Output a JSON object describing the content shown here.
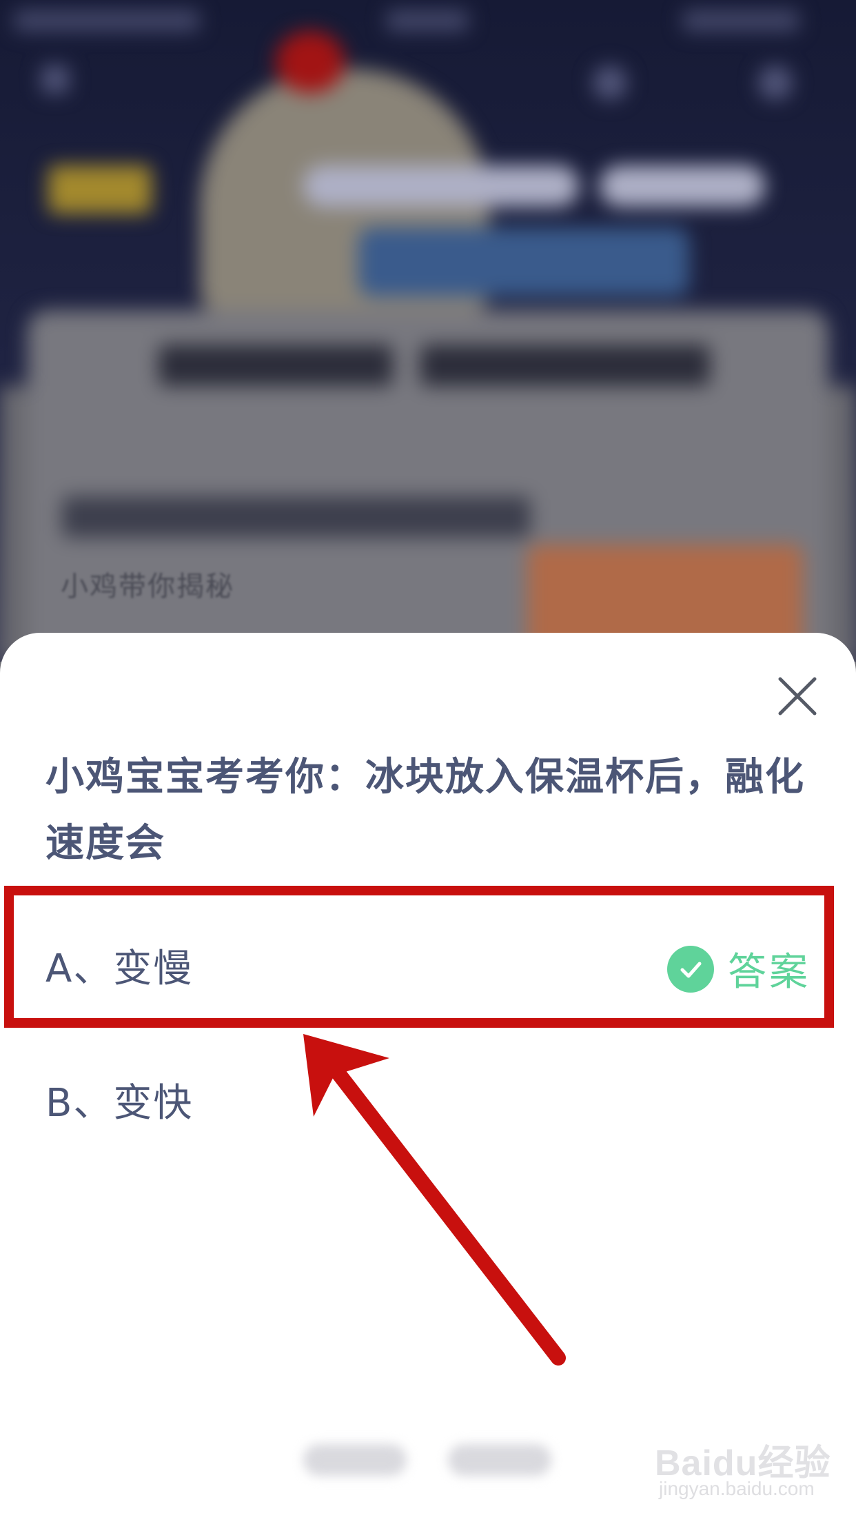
{
  "background": {
    "subtitle": "小鸡带你揭秘"
  },
  "quiz": {
    "question": "小鸡宝宝考考你：冰块放入保温杯后，融化速度会",
    "options": [
      {
        "label": "A、变慢",
        "is_answer": true,
        "answer_tag": "答案"
      },
      {
        "label": "B、变快",
        "is_answer": false
      }
    ]
  },
  "colors": {
    "question_text": "#4c5676",
    "answer_green": "#5fd39a",
    "annotation_red": "#c8100e"
  },
  "watermark": {
    "main": "Baidu经验",
    "sub": "jingyan.baidu.com"
  },
  "icons": {
    "close": "close-icon",
    "check": "check-icon"
  }
}
